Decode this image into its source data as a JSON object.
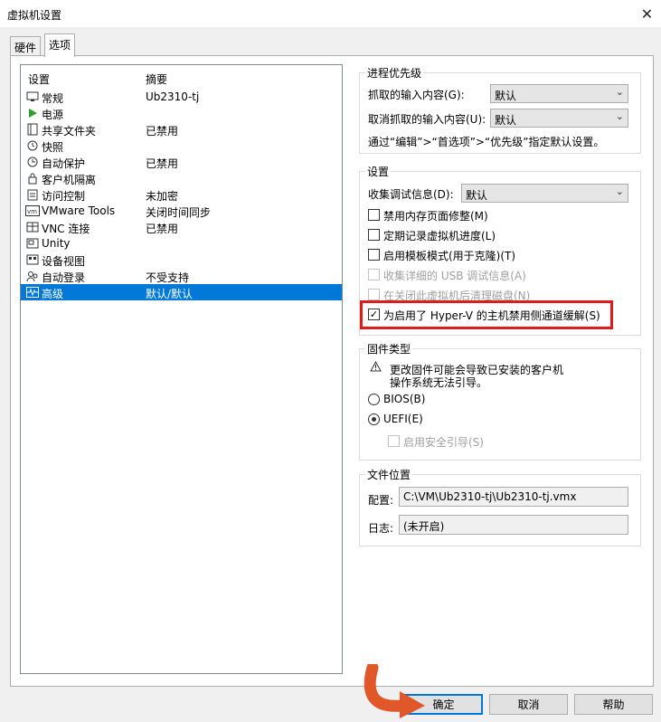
{
  "window": {
    "title": "虚拟机设置"
  },
  "tabs": [
    {
      "label": "硬件"
    },
    {
      "label": "选项"
    }
  ],
  "list": {
    "headers": {
      "setting": "设置",
      "summary": "摘要"
    },
    "rows": [
      {
        "name": "常规",
        "summary": "Ub2310-tj",
        "icon": "monitor-icon"
      },
      {
        "name": "电源",
        "summary": "",
        "icon": "power-play-icon"
      },
      {
        "name": "共享文件夹",
        "summary": "已禁用",
        "icon": "shared-folder-icon"
      },
      {
        "name": "快照",
        "summary": "",
        "icon": "snapshot-icon"
      },
      {
        "name": "自动保护",
        "summary": "已禁用",
        "icon": "clock-icon"
      },
      {
        "name": "客户机隔离",
        "summary": "",
        "icon": "lock-icon"
      },
      {
        "name": "访问控制",
        "summary": "未加密",
        "icon": "access-control-icon"
      },
      {
        "name": "VMware Tools",
        "summary": "关闭时间同步",
        "icon": "vmware-tools-icon"
      },
      {
        "name": "VNC 连接",
        "summary": "已禁用",
        "icon": "vnc-icon"
      },
      {
        "name": "Unity",
        "summary": "",
        "icon": "unity-icon"
      },
      {
        "name": "设备视图",
        "summary": "",
        "icon": "device-view-icon"
      },
      {
        "name": "自动登录",
        "summary": "不受支持",
        "icon": "users-icon"
      },
      {
        "name": "高级",
        "summary": "默认/默认",
        "icon": "waveform-icon",
        "selected": true
      }
    ]
  },
  "priority": {
    "title": "进程优先级",
    "grab_label": "抓取的输入内容(G):",
    "grab_value": "默认",
    "ungrab_label": "取消抓取的输入内容(U):",
    "ungrab_value": "默认",
    "hint": "通过“编辑”>“首选项”>“优先级”指定默认设置。"
  },
  "settings": {
    "title": "设置",
    "debug_label": "收集调试信息(D):",
    "debug_value": "默认",
    "checkboxes": [
      {
        "label": "禁用内存页面修整(M)",
        "checked": false,
        "disabled": false
      },
      {
        "label": "定期记录虚拟机进度(L)",
        "checked": false,
        "disabled": false
      },
      {
        "label": "启用模板模式(用于克隆)(T)",
        "checked": false,
        "disabled": false
      },
      {
        "label": "收集详细的 USB 调试信息(A)",
        "checked": false,
        "disabled": true
      },
      {
        "label": "在关闭此虚拟机后清理磁盘(N)",
        "checked": false,
        "disabled": true
      },
      {
        "label": "为启用了 Hyper-V 的主机禁用侧通道缓解(S)",
        "checked": true,
        "disabled": false
      }
    ],
    "check_mark": "✓",
    "highlight_color": "#e01b1b"
  },
  "firmware": {
    "title": "固件类型",
    "warning": "更改固件可能会导致已安装的客户机操作系统无法引导。",
    "warning_line1": "更改固件可能会导致已安装的客户机",
    "warning_line2": "操作系统无法引导。",
    "options": [
      {
        "label": "BIOS(B)",
        "selected": false
      },
      {
        "label": "UEFI(E)",
        "selected": true
      }
    ],
    "secure_boot_label": "启用安全引导(S)"
  },
  "file_location": {
    "title": "文件位置",
    "config_label": "配置:",
    "config_value": "C:\\VM\\Ub2310-tj\\Ub2310-tj.vmx",
    "log_label": "日志:",
    "log_value": "(未开启)"
  },
  "buttons": {
    "ok": "确定",
    "cancel": "取消",
    "help": "帮助"
  },
  "colors": {
    "accent": "#0078d7",
    "annotation_arrow": "#e0572a"
  }
}
